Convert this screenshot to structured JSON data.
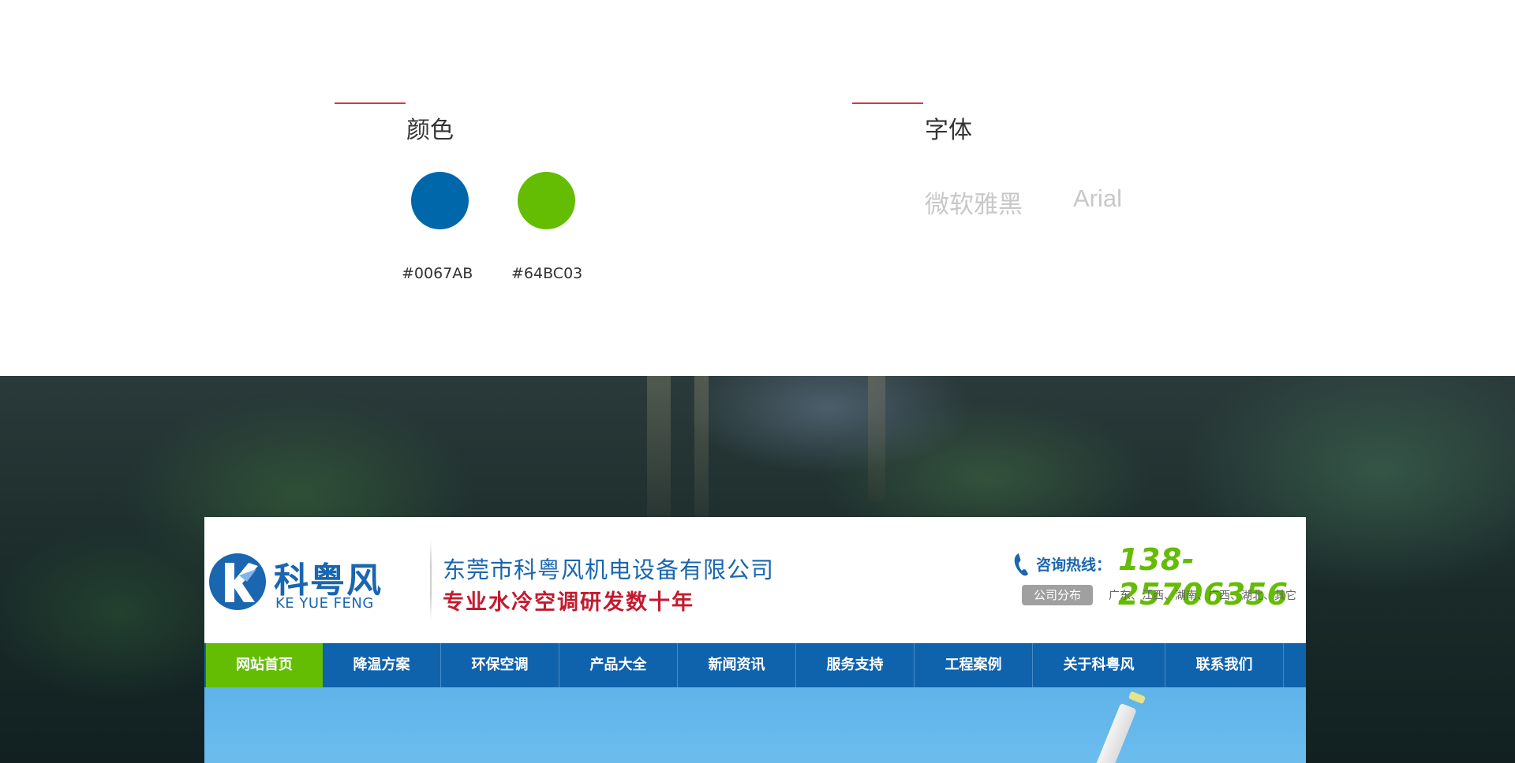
{
  "spec": {
    "colors_title": "颜色",
    "fonts_title": "字体",
    "colors": [
      {
        "hex": "#0067AB",
        "label": "#0067AB"
      },
      {
        "hex": "#64BC03",
        "label": "#64BC03"
      }
    ],
    "fonts": [
      "微软雅黑",
      "Arial"
    ],
    "accent_line_color": "#d9363e"
  },
  "mock_site": {
    "logo_cn": "科粤风",
    "logo_en": "KE YUE FENG",
    "company_name": "东莞市科粤风机电设备有限公司",
    "slogan": "专业水冷空调研发数十年",
    "hotline_label": "咨询热线：",
    "hotline_number": "138-25706356",
    "branch_badge": "公司分布",
    "branch_list": "广东、江西、湖南、广西、湖北、其它",
    "nav": [
      {
        "label": "网站首页",
        "active": true
      },
      {
        "label": "降温方案",
        "active": false
      },
      {
        "label": "环保空调",
        "active": false
      },
      {
        "label": "产品大全",
        "active": false
      },
      {
        "label": "新闻资讯",
        "active": false
      },
      {
        "label": "服务支持",
        "active": false
      },
      {
        "label": "工程案例",
        "active": false
      },
      {
        "label": "关于科粤风",
        "active": false
      },
      {
        "label": "联系我们",
        "active": false
      }
    ],
    "brand_blue": "#1a66b0",
    "brand_green": "#64bc03",
    "slogan_red": "#c41a2e"
  }
}
